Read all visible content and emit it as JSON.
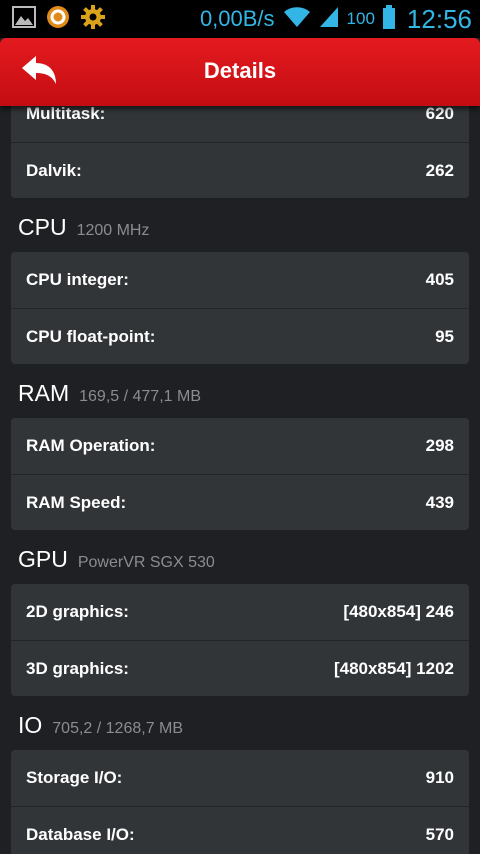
{
  "statusbar": {
    "speed": "0,00B/s",
    "battery": "100",
    "time": "12:56"
  },
  "header": {
    "title": "Details"
  },
  "top_card": {
    "rows": [
      {
        "label": "Multitask:",
        "value": "620"
      },
      {
        "label": "Dalvik:",
        "value": "262"
      }
    ]
  },
  "sections": [
    {
      "title": "CPU",
      "subtitle": "1200 MHz",
      "rows": [
        {
          "label": "CPU integer:",
          "value": "405"
        },
        {
          "label": "CPU float-point:",
          "value": "95"
        }
      ]
    },
    {
      "title": "RAM",
      "subtitle": "169,5 / 477,1 MB",
      "rows": [
        {
          "label": "RAM Operation:",
          "value": "298"
        },
        {
          "label": "RAM Speed:",
          "value": "439"
        }
      ]
    },
    {
      "title": "GPU",
      "subtitle": "PowerVR SGX 530",
      "rows": [
        {
          "label": "2D graphics:",
          "value": "[480x854] 246"
        },
        {
          "label": "3D graphics:",
          "value": "[480x854] 1202"
        }
      ]
    },
    {
      "title": "IO",
      "subtitle": "705,2 / 1268,7 MB",
      "rows": [
        {
          "label": "Storage I/O:",
          "value": "910"
        },
        {
          "label": "Database I/O:",
          "value": "570"
        }
      ]
    }
  ]
}
